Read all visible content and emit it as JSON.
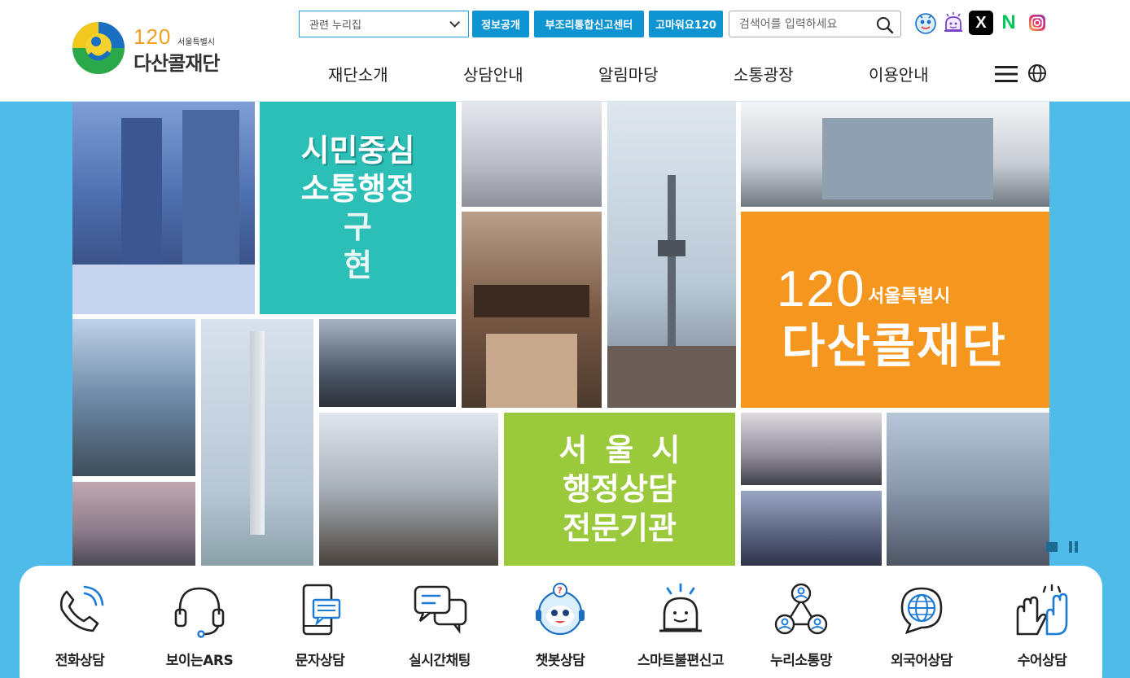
{
  "header": {
    "logo": {
      "number": "120",
      "sub": "서울특별시",
      "name": "다산콜재단"
    },
    "related_select": {
      "value": "관련 누리집"
    },
    "buttons": [
      "정보공개",
      "부조리통합신고센터",
      "고마워요120"
    ],
    "search": {
      "placeholder": "검색어를 입력하세요"
    },
    "sns": [
      {
        "icon": "haechi-icon"
      },
      {
        "icon": "smart-bell-icon"
      },
      {
        "icon": "x-icon",
        "label": "X"
      },
      {
        "icon": "naver-icon",
        "label": "N"
      },
      {
        "icon": "instagram-icon"
      }
    ],
    "nav": [
      "재단소개",
      "상담안내",
      "알림마당",
      "소통광장",
      "이용안내"
    ]
  },
  "hero": {
    "teal_text": [
      "시민중심",
      "소통행정",
      "구현"
    ],
    "orange_text": {
      "number": "120",
      "sub": "서울특별시",
      "name": "다산콜재단"
    },
    "green_text": [
      "서울시",
      "행정상담",
      "전문기관"
    ]
  },
  "quick_menu": [
    {
      "label": "전화상담",
      "icon": "phone-icon"
    },
    {
      "label": "보이는ARS",
      "icon": "headset-icon"
    },
    {
      "label": "문자상담",
      "icon": "mobile-message-icon"
    },
    {
      "label": "실시간채팅",
      "icon": "chat-bubbles-icon"
    },
    {
      "label": "챗봇상담",
      "icon": "chatbot-icon"
    },
    {
      "label": "스마트불편신고",
      "icon": "alarm-bell-icon"
    },
    {
      "label": "누리소통망",
      "icon": "social-network-icon"
    },
    {
      "label": "외국어상담",
      "icon": "globe-chat-icon"
    },
    {
      "label": "수어상담",
      "icon": "sign-language-icon"
    }
  ],
  "colors": {
    "primary": "#0f94d2",
    "hero_bg": "#4fbbe8",
    "teal": "#2cbfb8",
    "orange": "#f5961f",
    "green": "#9bc93c"
  }
}
